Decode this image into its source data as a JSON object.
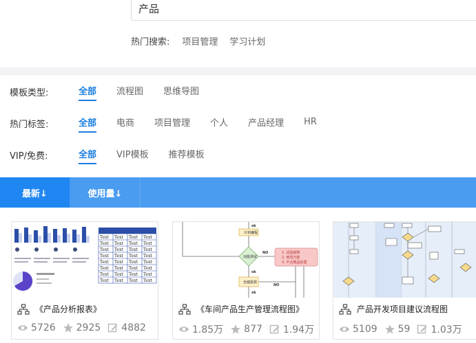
{
  "search": {
    "value": "产品",
    "hot_label": "热门搜索:",
    "hot_keywords": [
      "项目管理",
      "学习计划"
    ]
  },
  "filters": {
    "type": {
      "label": "模板类型:",
      "options": [
        "全部",
        "流程图",
        "思维导图"
      ]
    },
    "tags": {
      "label": "热门标签:",
      "options": [
        "全部",
        "电商",
        "项目管理",
        "个人",
        "产品经理",
        "HR"
      ]
    },
    "vip": {
      "label": "VIP/免费:",
      "options": [
        "全部",
        "VIP模板",
        "推荐模板"
      ]
    }
  },
  "sort": {
    "newest": "最新↓",
    "usage": "使用量↓"
  },
  "cards": [
    {
      "title": "《产品分析报表》",
      "views": "5726",
      "stars": "2925",
      "uses": "4882"
    },
    {
      "title": "《车间产品生产管理流程图》",
      "views": "1.85万",
      "stars": "877",
      "uses": "1.94万"
    },
    {
      "title": "产品开发项目建议流程图",
      "views": "5109",
      "stars": "59",
      "uses": "1.03万"
    }
  ],
  "thumb_text": {
    "table_cell": "Text",
    "flow_ok": "ok",
    "flow_no": "NO",
    "flow_plan": "计划编程",
    "flow_test": "功能测试",
    "flow_release": "全面投放",
    "flow_note1": "1. 试验故障",
    "flow_note2": "2. 修改方案",
    "flow_note3": "3. 不合格品处理"
  },
  "colors": {
    "accent": "#1a7ee0",
    "sortbar": "#4a9cf0",
    "sort_active": "#1f86f2"
  }
}
